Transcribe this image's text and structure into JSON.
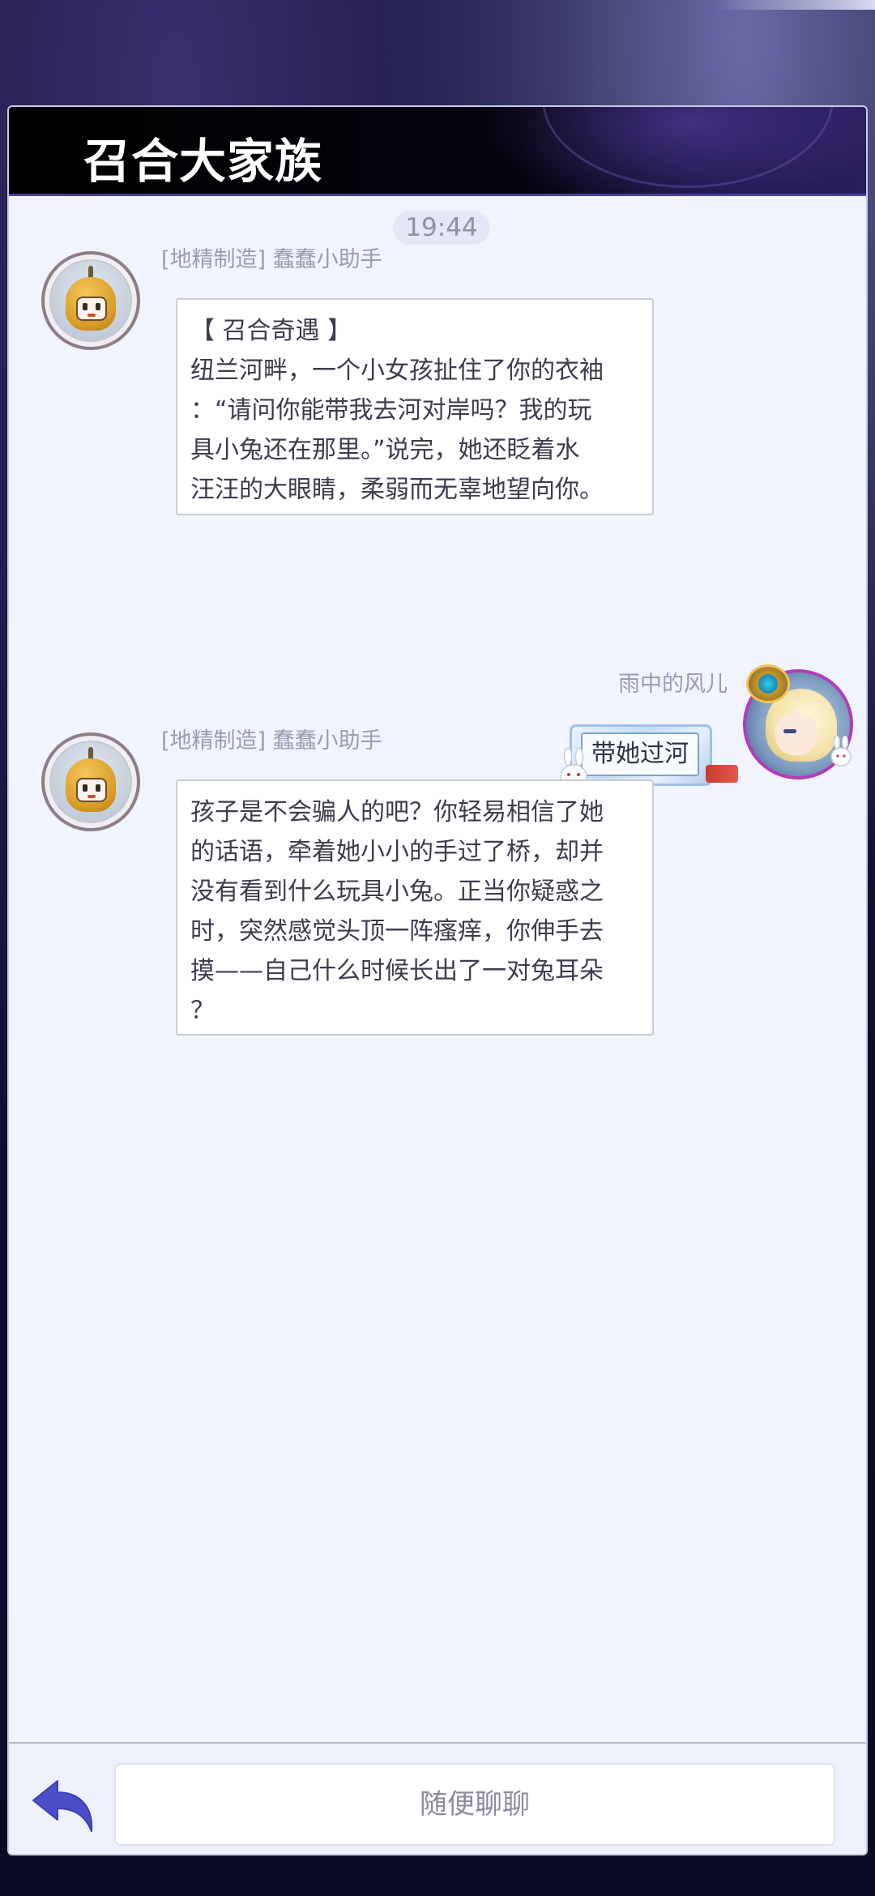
{
  "header": {
    "title": "召合大家族"
  },
  "chat": {
    "timestamp": "19:44",
    "messages": [
      {
        "sender": "[地精制造] 蠢蠢小助手",
        "lines": [
          "【 召合奇遇 】",
          "纽兰河畔，一个小女孩扯住了你的衣袖",
          "：“请问你能带我去河对岸吗？我的玩",
          "具小兔还在那里。”说完，她还眨着水",
          "汪汪的大眼睛，柔弱而无辜地望向你。"
        ]
      },
      {
        "sender": "雨中的风儿",
        "text": "带她过河"
      },
      {
        "sender": "[地精制造] 蠢蠢小助手",
        "lines": [
          "孩子是不会骗人的吧？你轻易相信了她",
          "的话语，牵着她小小的手过了桥，却并",
          "没有看到什么玩具小兔。正当你疑惑之",
          "时，突然感觉头顶一阵瘙痒，你伸手去",
          "摸——自己什么时候长出了一对兔耳朵",
          "？"
        ]
      }
    ]
  },
  "input": {
    "placeholder": "随便聊聊"
  },
  "icons": {
    "back": "back-arrow-icon"
  },
  "colors": {
    "panel_bg": "#f1f3fd",
    "accent": "#4a4fc7",
    "header_bg": "#000000"
  }
}
